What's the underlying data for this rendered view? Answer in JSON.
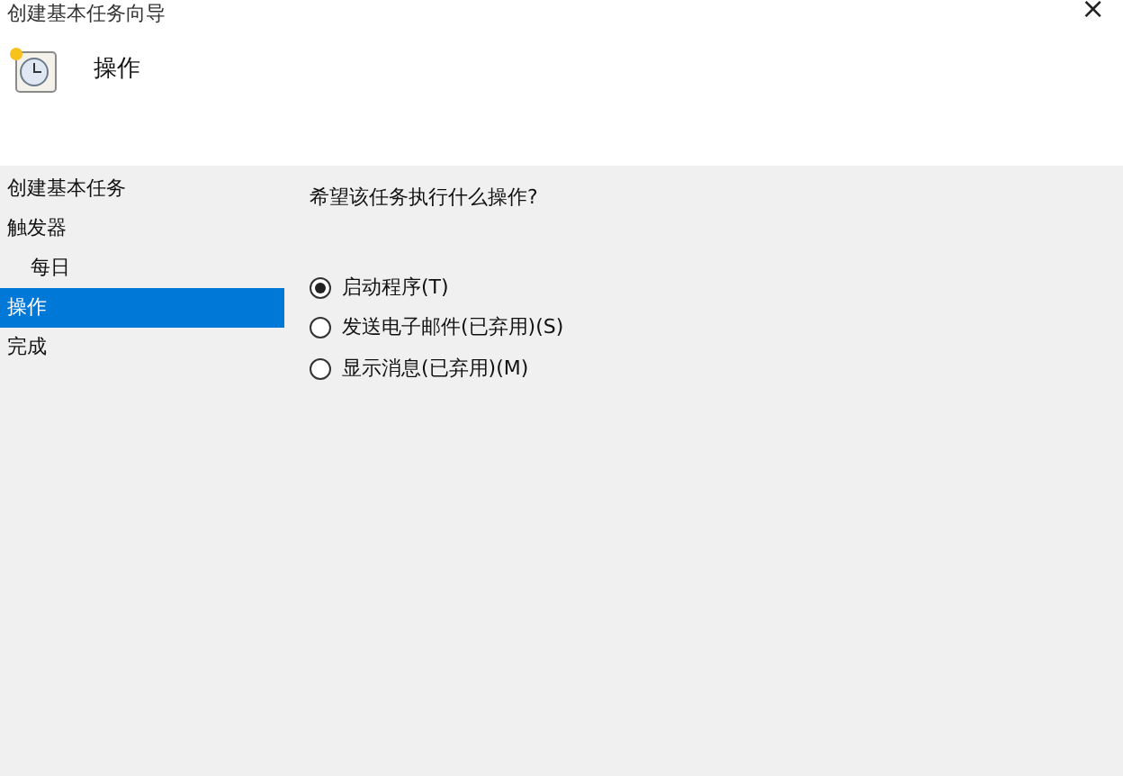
{
  "window": {
    "title": "创建基本任务向导",
    "close": "×"
  },
  "header": {
    "title": "操作"
  },
  "sidebar": {
    "items": [
      {
        "label": "创建基本任务",
        "selected": false
      },
      {
        "label": "触发器",
        "selected": false,
        "children": [
          {
            "label": "每日",
            "selected": false
          }
        ]
      },
      {
        "label": "操作",
        "selected": true
      },
      {
        "label": "完成",
        "selected": false
      }
    ]
  },
  "content": {
    "question": "希望该任务执行什么操作?",
    "options": [
      {
        "label": "启动程序(T)",
        "selected": true
      },
      {
        "label": "发送电子邮件(已弃用)(S)",
        "selected": false
      },
      {
        "label": "显示消息(已弃用)(M)",
        "selected": false
      }
    ]
  }
}
